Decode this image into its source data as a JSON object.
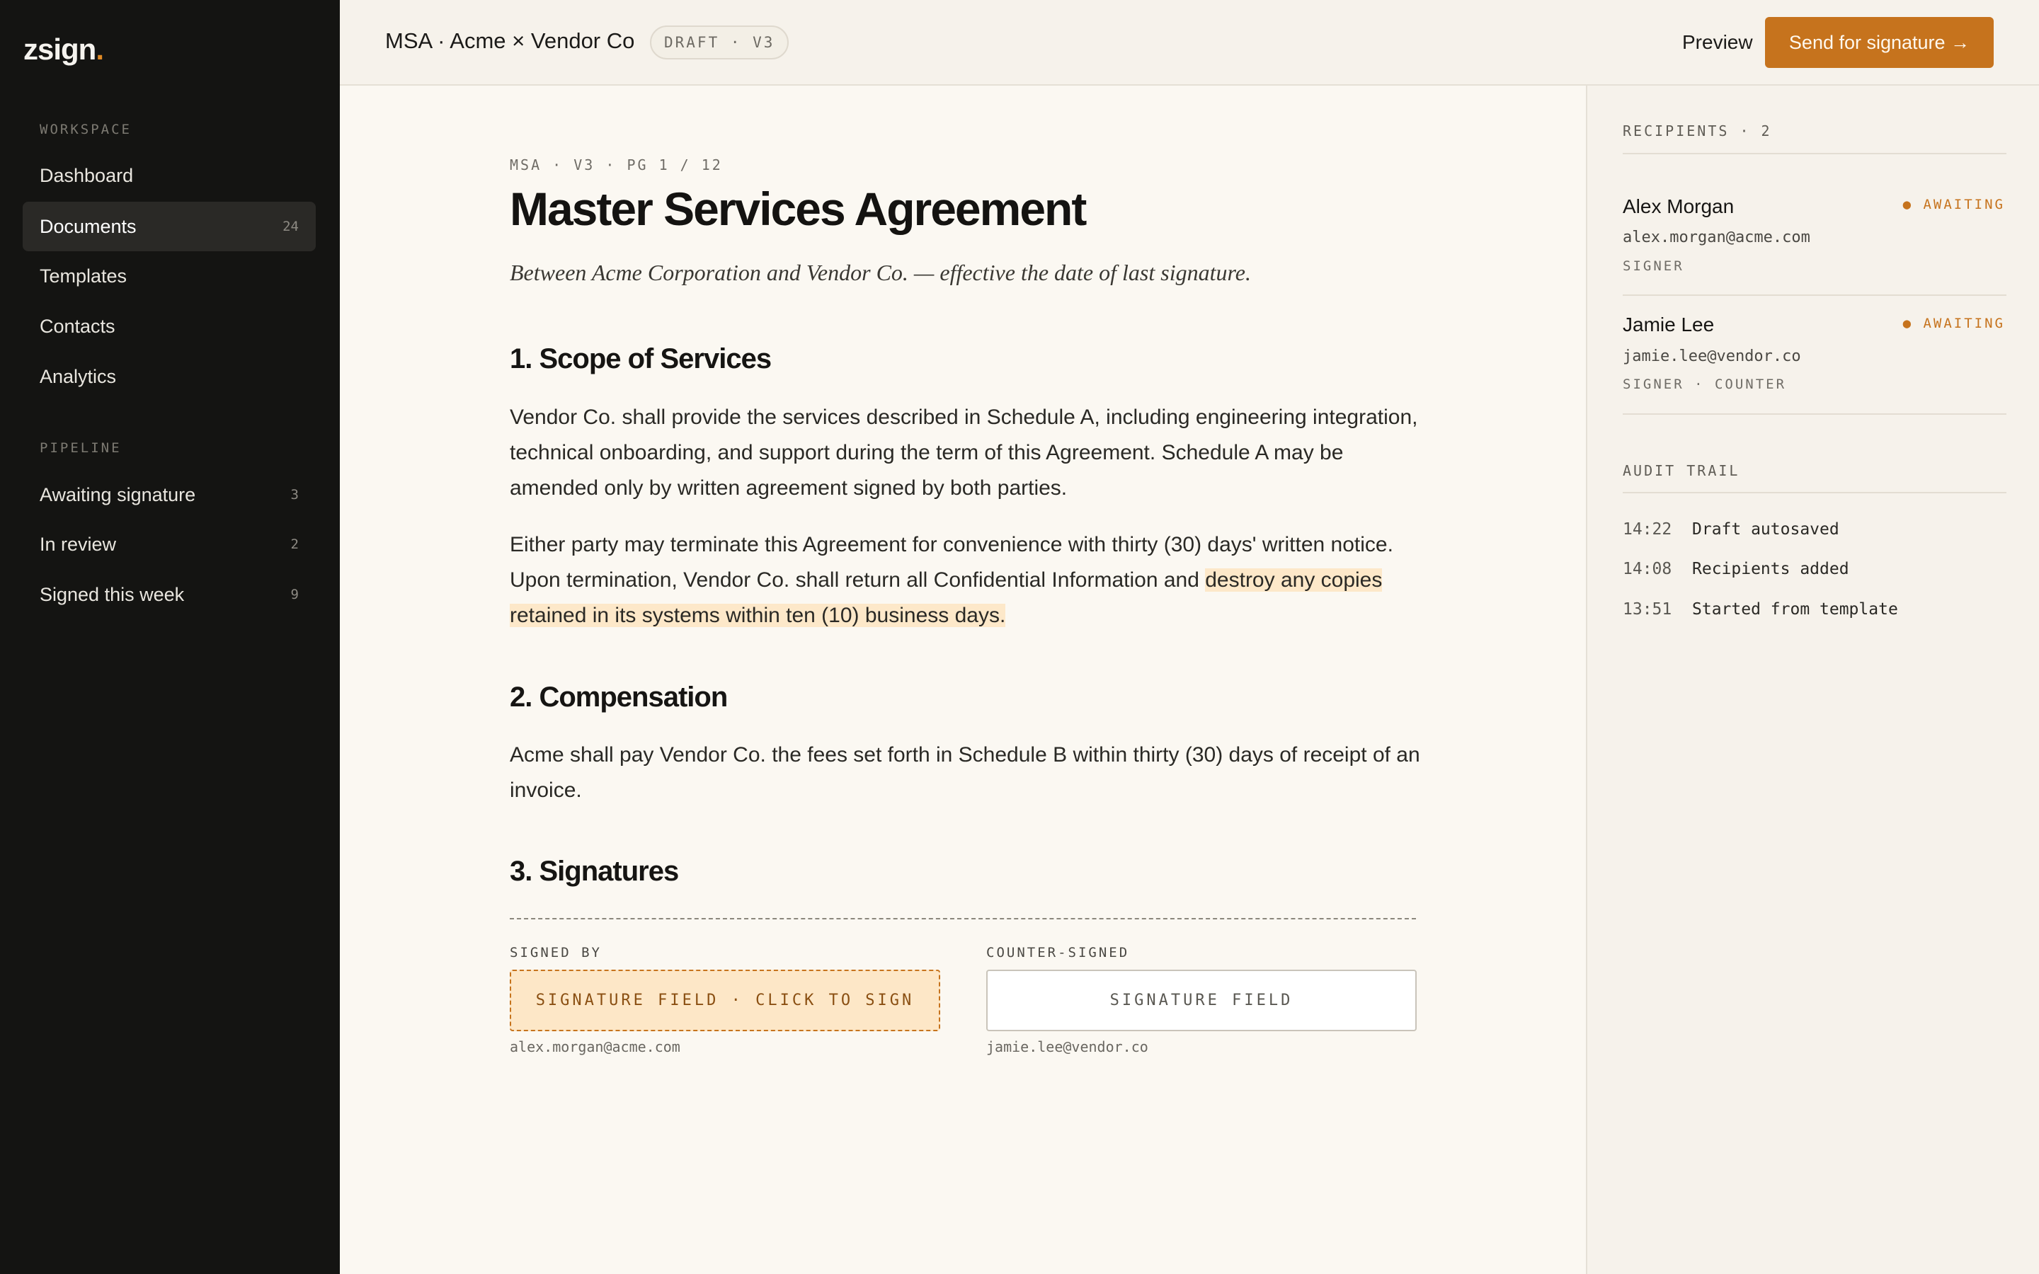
{
  "app": {
    "logo": "zsign",
    "logo_dot": "."
  },
  "sidebar": {
    "workspace_label": "WORKSPACE",
    "workspace_items": [
      {
        "label": "Dashboard",
        "count": ""
      },
      {
        "label": "Documents",
        "count": "24"
      },
      {
        "label": "Templates",
        "count": ""
      },
      {
        "label": "Contacts",
        "count": ""
      },
      {
        "label": "Analytics",
        "count": ""
      }
    ],
    "pipeline_label": "PIPELINE",
    "pipeline_items": [
      {
        "label": "Awaiting signature",
        "count": "3"
      },
      {
        "label": "In review",
        "count": "2"
      },
      {
        "label": "Signed this week",
        "count": "9"
      }
    ]
  },
  "header": {
    "title": "MSA · Acme × Vendor Co",
    "badge": "DRAFT · V3",
    "preview_label": "Preview",
    "send_label": "Send for signature →"
  },
  "document": {
    "meta": "MSA · V3 · PG 1 / 12",
    "heading": "Master Services Agreement",
    "subtitle": "Between Acme Corporation and Vendor Co. — effective the date of last signature.",
    "sections": [
      {
        "title": "1. Scope of Services",
        "paragraphs": [
          "Vendor Co. shall provide the services described in Schedule A, including engineering integration, technical onboarding, and support during the term of this Agreement. Schedule A may be amended only by written agreement signed by both parties.",
          "Either party may terminate this Agreement for convenience with thirty (30) days' written notice. Upon termination, Vendor Co. shall return all Confidential Information and "
        ],
        "highlight": "destroy any copies retained in its systems within ten (10) business days."
      },
      {
        "title": "2. Compensation",
        "paragraphs": [
          "Acme shall pay Vendor Co. the fees set forth in Schedule B within thirty (30) days of receipt of an invoice."
        ]
      },
      {
        "title": "3. Signatures"
      }
    ],
    "signatures": [
      {
        "label": "SIGNED BY",
        "field": "SIGNATURE FIELD · CLICK TO SIGN",
        "email": "alex.morgan@acme.com"
      },
      {
        "label": "COUNTER-SIGNED",
        "field": "SIGNATURE FIELD",
        "email": "jamie.lee@vendor.co"
      }
    ]
  },
  "panel": {
    "recipients_label": "RECIPIENTS · 2",
    "recipients": [
      {
        "name": "Alex Morgan",
        "status": "● AWAITING",
        "email": "alex.morgan@acme.com",
        "role": "SIGNER"
      },
      {
        "name": "Jamie Lee",
        "status": "● AWAITING",
        "email": "jamie.lee@vendor.co",
        "role": "SIGNER · COUNTER"
      }
    ],
    "audit_label": "AUDIT TRAIL",
    "audit": [
      {
        "time": "14:22",
        "event": "Draft autosaved"
      },
      {
        "time": "14:08",
        "event": "Recipients added"
      },
      {
        "time": "13:51",
        "event": "Started from template"
      }
    ]
  },
  "colors": {
    "accent": "#c6731d",
    "sidebar_bg": "#141412",
    "page_bg": "#fbf8f2",
    "highlight": "#fde8c9"
  }
}
